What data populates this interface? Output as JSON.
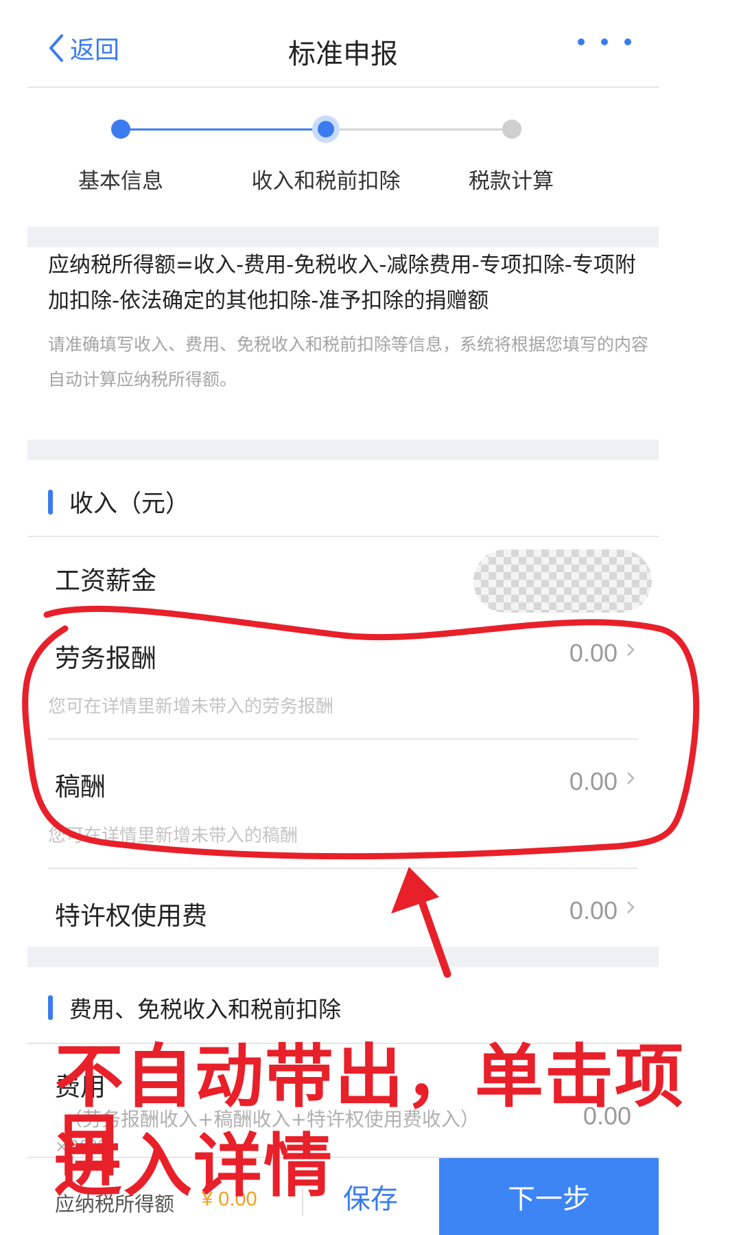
{
  "header": {
    "back_label": "返回",
    "title": "标准申报"
  },
  "steps": [
    {
      "label": "基本信息",
      "state": "done"
    },
    {
      "label": "收入和税前扣除",
      "state": "current"
    },
    {
      "label": "税款计算",
      "state": "pending"
    }
  ],
  "intro": {
    "formula": "应纳税所得额=收入-费用-免税收入-减除费用-专项扣除-专项附加扣除-依法确定的其他扣除-准予扣除的捐赠额",
    "hint": "请准确填写收入、费用、免税收入和税前扣除等信息，系统将根据您填写的内容自动计算应纳税所得额。"
  },
  "income": {
    "title": "收入（元）",
    "items": [
      {
        "label": "工资薪金",
        "value": null,
        "sub": ""
      },
      {
        "label": "劳务报酬",
        "value": "0.00",
        "sub": "您可在详情里新增未带入的劳务报酬"
      },
      {
        "label": "稿酬",
        "value": "0.00",
        "sub": "您可在详情里新增未带入的稿酬"
      },
      {
        "label": "特许权使用费",
        "value": "0.00",
        "sub": ""
      }
    ]
  },
  "expense": {
    "title": "费用、免税收入和税前扣除",
    "item_label": "费用",
    "item_sub": "（劳务报酬收入+稿酬收入+特许权使用费收入）",
    "item_sub2": "×20%",
    "value": "0.00"
  },
  "bottom": {
    "tax_label": "应纳税所得额",
    "tax_value": "¥ 0.00",
    "save_label": "保存",
    "next_label": "下一步"
  },
  "annotation": {
    "line1": "不自动带出，单击项目",
    "line2": "进入详情",
    "color": "#e8202a"
  },
  "colors": {
    "accent": "#3a7cf0",
    "button": "#3d84f5",
    "step_pending": "#cfcfcf",
    "tax_value": "#f0a020"
  }
}
